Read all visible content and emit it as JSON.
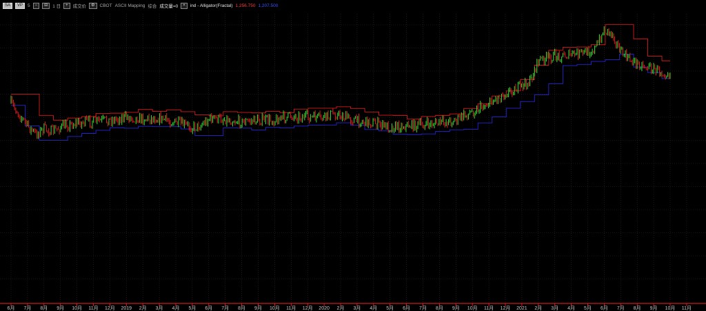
{
  "toolbar": {
    "btn1": "SA",
    "btn2": "VP",
    "btn3_prefix": "5",
    "period": "1 日",
    "price_type": "成交价",
    "exchange": "CBOT",
    "mapping": "ASCII Mapping",
    "combined": "综合",
    "volume": "成交量=0",
    "indicator": "ind - Alligator(Fractal)",
    "upper_val": "1,256.750",
    "lower_val": "1,207.500"
  },
  "colors": {
    "background": "#000000",
    "grid": "#2c2c2c",
    "axis": "#ff2020",
    "candle_up": "#33e133",
    "candle_down": "#e11f1f",
    "upper_band": "#d61a1a",
    "lower_band": "#2424d6"
  },
  "chart_data": {
    "type": "candlestick",
    "x_tick_labels": [
      "6月",
      "7月",
      "8月",
      "9月",
      "10月",
      "11月",
      "12月",
      "2019",
      "2月",
      "3月",
      "4月",
      "5月",
      "6月",
      "7月",
      "8月",
      "9月",
      "10月",
      "11月",
      "12月",
      "2020",
      "2月",
      "3月",
      "4月",
      "5月",
      "6月",
      "7月",
      "8月",
      "9月",
      "10月",
      "11月",
      "12月",
      "2021",
      "2月",
      "3月",
      "4月",
      "5月",
      "6月",
      "7月",
      "8月",
      "9月",
      "10月",
      "11月"
    ],
    "series_anchor": [
      [
        0,
        0.315
      ],
      [
        1.0,
        0.395
      ],
      [
        1.5,
        0.425
      ],
      [
        2.0,
        0.405
      ],
      [
        2.5,
        0.415
      ],
      [
        3.0,
        0.4
      ],
      [
        4.0,
        0.385
      ],
      [
        5.0,
        0.38
      ],
      [
        6.0,
        0.375
      ],
      [
        7.0,
        0.365
      ],
      [
        8.0,
        0.37
      ],
      [
        9.0,
        0.368
      ],
      [
        10.0,
        0.385
      ],
      [
        11.0,
        0.4
      ],
      [
        11.5,
        0.395
      ],
      [
        12.0,
        0.37
      ],
      [
        13.0,
        0.372
      ],
      [
        14.0,
        0.382
      ],
      [
        15.0,
        0.375
      ],
      [
        16.0,
        0.375
      ],
      [
        17.0,
        0.36
      ],
      [
        18.0,
        0.365
      ],
      [
        19.0,
        0.368
      ],
      [
        19.5,
        0.352
      ],
      [
        20.0,
        0.36
      ],
      [
        21.0,
        0.378
      ],
      [
        22.0,
        0.385
      ],
      [
        23.0,
        0.4
      ],
      [
        24.0,
        0.395
      ],
      [
        25.0,
        0.392
      ],
      [
        26.0,
        0.385
      ],
      [
        27.0,
        0.375
      ],
      [
        28.0,
        0.345
      ],
      [
        29.0,
        0.315
      ],
      [
        30.0,
        0.28
      ],
      [
        31.0,
        0.255
      ],
      [
        31.5,
        0.24
      ],
      [
        32.0,
        0.165
      ],
      [
        33.0,
        0.15
      ],
      [
        34.0,
        0.145
      ],
      [
        35.0,
        0.135
      ],
      [
        35.5,
        0.12
      ],
      [
        36.0,
        0.055
      ],
      [
        36.5,
        0.07
      ],
      [
        37.0,
        0.135
      ],
      [
        37.5,
        0.16
      ],
      [
        38.0,
        0.175
      ],
      [
        39.0,
        0.195
      ],
      [
        39.5,
        0.205
      ],
      [
        40.0,
        0.21
      ]
    ],
    "month_count": 41,
    "note": ""
  }
}
